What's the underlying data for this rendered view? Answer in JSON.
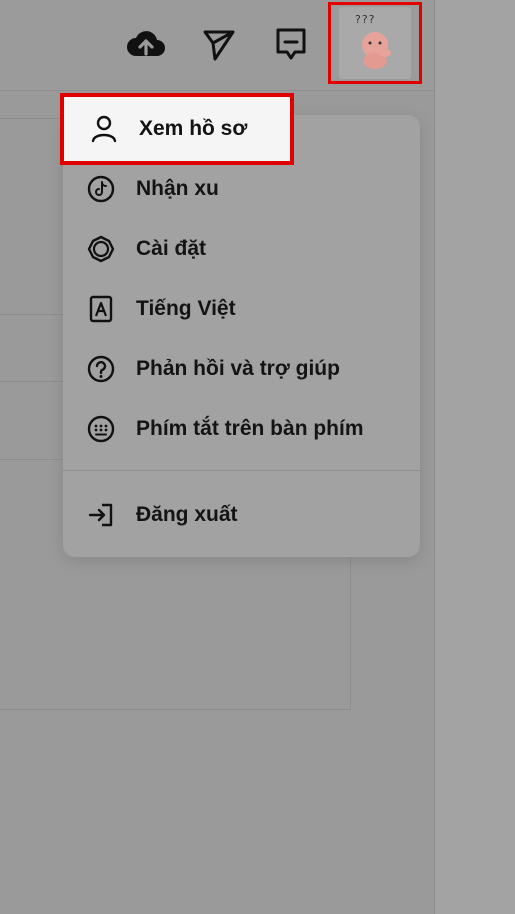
{
  "topbar": {
    "icons": [
      {
        "name": "upload-cloud-icon"
      },
      {
        "name": "send-icon"
      },
      {
        "name": "message-icon"
      }
    ],
    "avatar_caption": "???"
  },
  "menu": {
    "items": [
      {
        "label": "Xem hồ sơ",
        "icon": "user-icon"
      },
      {
        "label": "Nhận xu",
        "icon": "tiktok-coin-icon"
      },
      {
        "label": "Cài đặt",
        "icon": "settings-icon"
      },
      {
        "label": "Tiếng Việt",
        "icon": "language-icon"
      },
      {
        "label": "Phản hồi và trợ giúp",
        "icon": "help-icon"
      },
      {
        "label": "Phím tắt trên bàn phím",
        "icon": "keyboard-icon"
      },
      {
        "label": "Đăng xuất",
        "icon": "logout-icon"
      }
    ]
  },
  "colors": {
    "highlight_border": "#e00000",
    "overlay": "#9a9a9a",
    "menu_bg": "#a2a2a2"
  }
}
